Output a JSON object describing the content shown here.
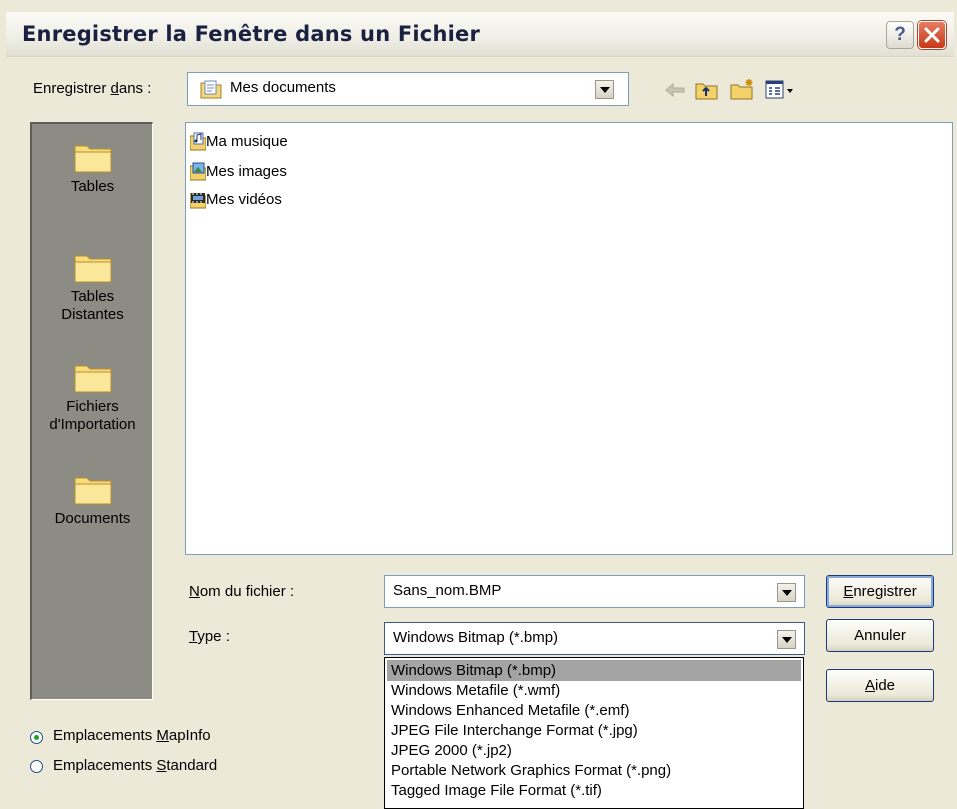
{
  "window": {
    "title": "Enregistrer la Fenêtre dans un Fichier",
    "help_glyph": "?",
    "close_icon": "close-icon"
  },
  "save_in": {
    "label_pre": "Enregistrer ",
    "label_accel": "d",
    "label_post": "ans :",
    "value": "Mes documents",
    "value_icon": "documents-folder-icon"
  },
  "toolbar": {
    "icons": [
      "back-arrow-icon",
      "up-folder-icon",
      "new-folder-icon",
      "view-menu-icon"
    ]
  },
  "places": [
    {
      "label_lines": [
        "Tables"
      ],
      "icon": "folder-icon"
    },
    {
      "label_lines": [
        "Tables",
        "Distantes"
      ],
      "icon": "folder-icon"
    },
    {
      "label_lines": [
        "Fichiers",
        "d'Importation"
      ],
      "icon": "folder-icon"
    },
    {
      "label_lines": [
        "Documents"
      ],
      "icon": "folder-icon"
    }
  ],
  "files": [
    {
      "name": "Ma musique",
      "icon": "music-folder-icon"
    },
    {
      "name": "Mes images",
      "icon": "pictures-folder-icon"
    },
    {
      "name": "Mes vidéos",
      "icon": "videos-folder-icon"
    }
  ],
  "filename": {
    "label_accel": "N",
    "label_post": "om du fichier :",
    "value": "Sans_nom.BMP"
  },
  "type": {
    "label_accel": "T",
    "label_post": "ype :",
    "value": "Windows Bitmap (*.bmp)",
    "options": [
      "Windows Bitmap (*.bmp)",
      "Windows Metafile (*.wmf)",
      "Windows Enhanced Metafile (*.emf)",
      "JPEG File Interchange Format (*.jpg)",
      "JPEG 2000 (*.jp2)",
      "Portable Network Graphics Format (*.png)",
      "Tagged Image File Format (*.tif)"
    ],
    "selected_index": 0
  },
  "buttons": {
    "save_accel": "E",
    "save_post": "nregistrer",
    "cancel": "Annuler",
    "help_accel": "A",
    "help_post": "ide"
  },
  "locations": {
    "mapinfo_pre": "Emplacements ",
    "mapinfo_accel": "M",
    "mapinfo_post": "apInfo",
    "standard_pre": "Emplacements ",
    "standard_accel": "S",
    "standard_post": "tandard",
    "selected": "mapinfo"
  }
}
